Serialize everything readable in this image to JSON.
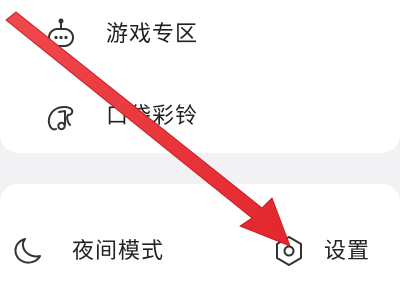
{
  "menu": {
    "items": [
      {
        "label": "游戏专区",
        "icon": "gamepad-icon"
      },
      {
        "label": "口袋彩铃",
        "icon": "music-note-icon"
      }
    ]
  },
  "bottom_bar": {
    "night_mode_label": "夜间模式",
    "night_mode_icon": "moon-icon",
    "settings_label": "设置",
    "settings_icon": "hexagon-gear-icon"
  },
  "colors": {
    "background": "#f2f2f4",
    "card": "#ffffff",
    "text": "#222222",
    "icon": "#333333",
    "annotation_arrow": "#e8373d"
  }
}
